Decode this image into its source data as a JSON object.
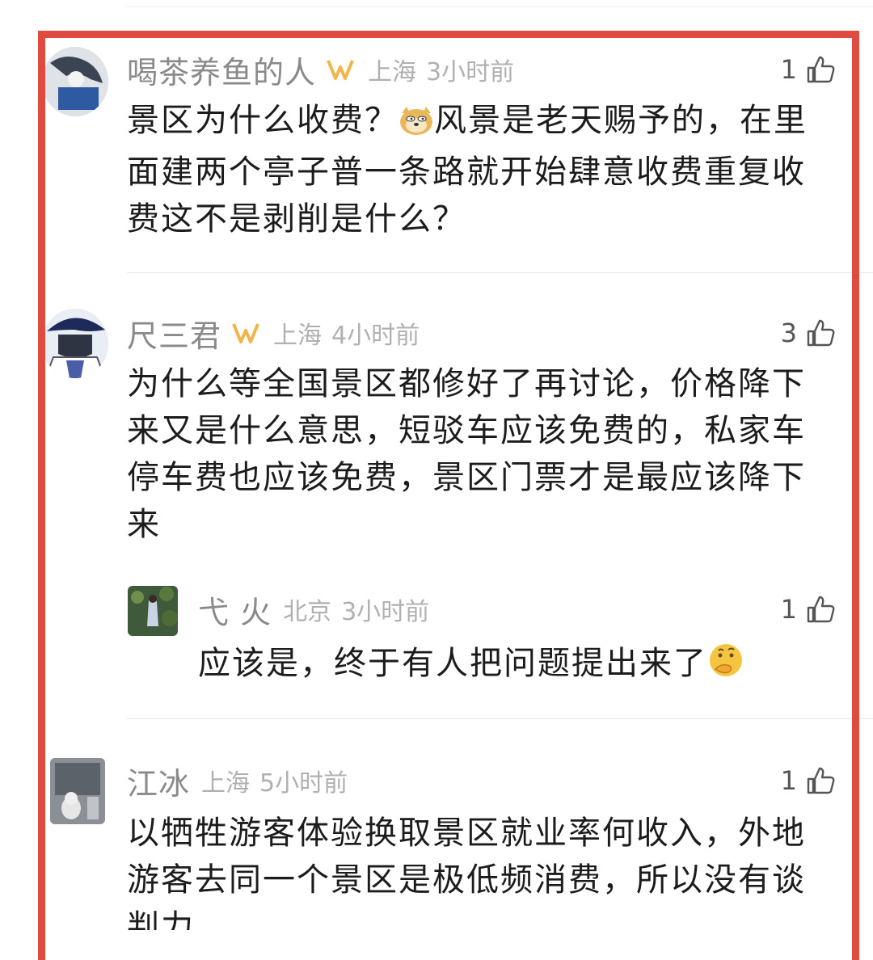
{
  "comments": [
    {
      "username": "喝茶养鱼的人",
      "location": "上海",
      "time": "3小时前",
      "likes": "1",
      "text_a": "景区为什么收费？",
      "emoji_a": "doge-emoji",
      "text_b": "风景是老天赐予的，在里面建两个亭子普一条路就开始肆意收费重复收费这不是剥削是什么？"
    },
    {
      "username": "尺三君",
      "location": "上海",
      "time": "4小时前",
      "likes": "3",
      "text": "为什么等全国景区都修好了再讨论，价格降下来又是什么意思，短驳车应该免费的，私家车停车费也应该免费，景区门票才是最应该降下来"
    },
    {
      "username": "弋 火",
      "location": "北京",
      "time": "3小时前",
      "likes": "1",
      "text": "应该是，终于有人把问题提出来了",
      "emoji": "thinking-face-emoji"
    },
    {
      "username": "江冰",
      "location": "上海",
      "time": "5小时前",
      "likes": "1",
      "text": "以牺牲游客体验换取景区就业率何收入，外地游客去同一个景区是极低频消费，所以没有谈判力"
    }
  ],
  "colors": {
    "frame": "#e04a3f",
    "vip_badge": "#f0b64a",
    "meta_text": "#b0b0b0"
  },
  "icons": {
    "like": "thumbs-up-outline-icon",
    "vip": "vip-badge-icon"
  }
}
